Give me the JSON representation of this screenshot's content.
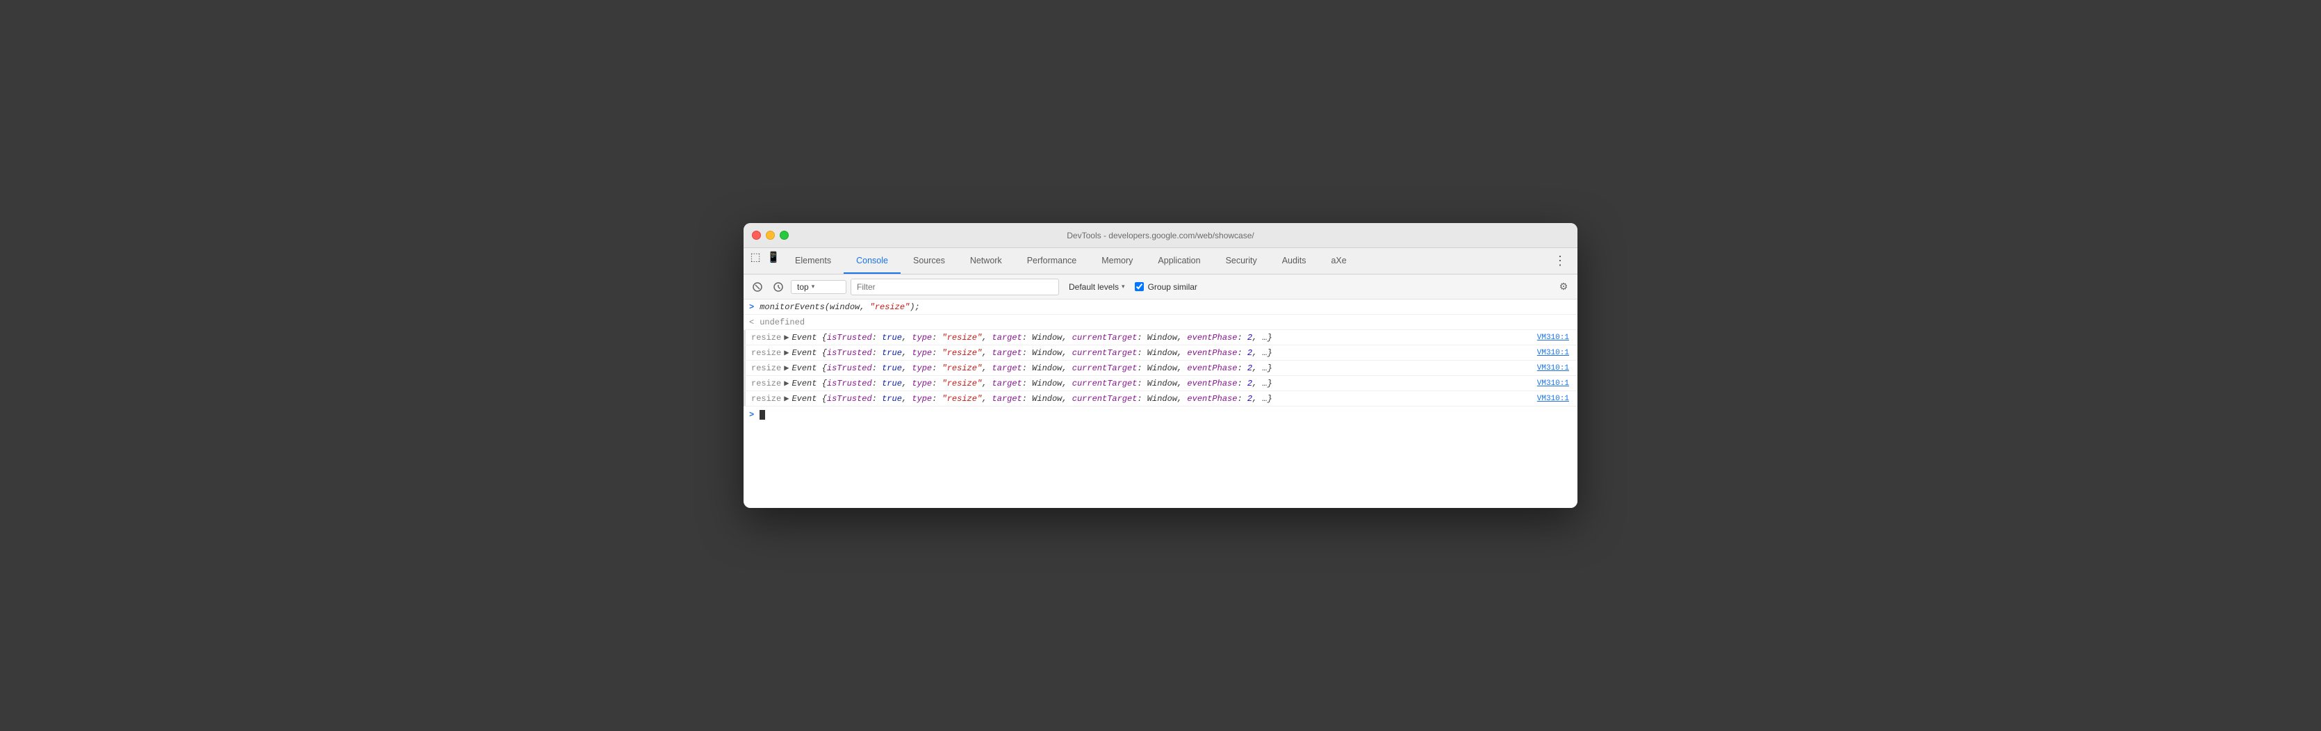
{
  "window": {
    "title": "DevTools - developers.google.com/web/showcase/"
  },
  "tabs": [
    {
      "id": "elements",
      "label": "Elements",
      "active": false
    },
    {
      "id": "console",
      "label": "Console",
      "active": true
    },
    {
      "id": "sources",
      "label": "Sources",
      "active": false
    },
    {
      "id": "network",
      "label": "Network",
      "active": false
    },
    {
      "id": "performance",
      "label": "Performance",
      "active": false
    },
    {
      "id": "memory",
      "label": "Memory",
      "active": false
    },
    {
      "id": "application",
      "label": "Application",
      "active": false
    },
    {
      "id": "security",
      "label": "Security",
      "active": false
    },
    {
      "id": "audits",
      "label": "Audits",
      "active": false
    },
    {
      "id": "axe",
      "label": "aXe",
      "active": false
    }
  ],
  "console_toolbar": {
    "context_label": "top",
    "context_chevron": "▾",
    "filter_placeholder": "Filter",
    "levels_label": "Default levels",
    "levels_chevron": "▾",
    "group_similar_label": "Group similar",
    "group_similar_checked": true,
    "gear_label": "⚙"
  },
  "console_lines": [
    {
      "type": "input",
      "content": "monitorEvents(window, \"resize\");"
    },
    {
      "type": "output",
      "content": "undefined"
    },
    {
      "type": "event",
      "label": "resize",
      "source": "VM310:1"
    },
    {
      "type": "event",
      "label": "resize",
      "source": "VM310:1"
    },
    {
      "type": "event",
      "label": "resize",
      "source": "VM310:1"
    },
    {
      "type": "event",
      "label": "resize",
      "source": "VM310:1"
    },
    {
      "type": "event",
      "label": "resize",
      "source": "VM310:1"
    }
  ],
  "event_detail": "{isTrusted: true, type: \"resize\", target: Window, currentTarget: Window, eventPhase: 2, …}",
  "colors": {
    "active_tab": "#1a73e8",
    "code_string": "#c41a16",
    "code_keyword": "#0d22aa",
    "code_number": "#1c00cf"
  }
}
